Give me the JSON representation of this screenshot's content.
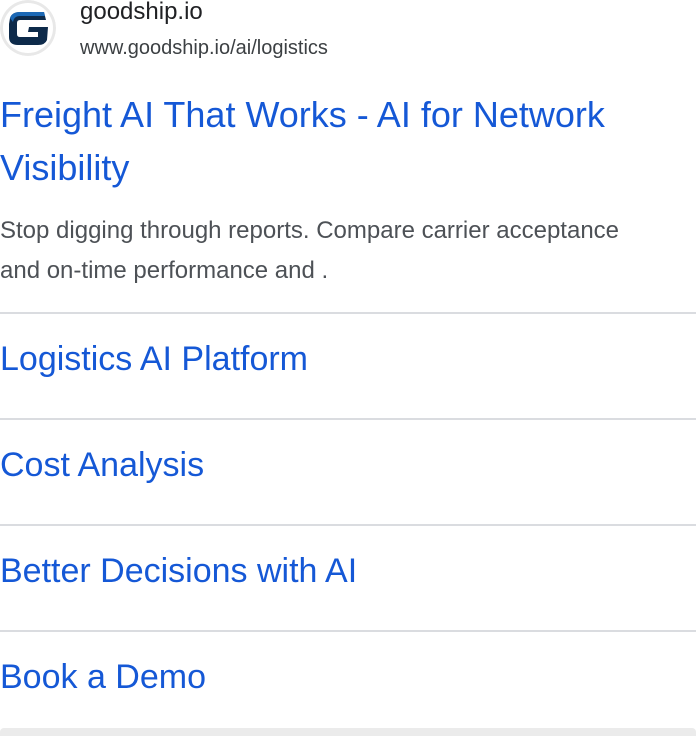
{
  "ad": {
    "site_name": "goodship.io",
    "display_url": "www.goodship.io/ai/logistics",
    "logo_icon": "goodship-g-logo",
    "headline": "Freight AI That Works - AI for Network Visibility",
    "description": "Stop digging through reports. Compare carrier acceptance and on-time performance and .",
    "sitelinks": [
      {
        "label": "Logistics AI Platform"
      },
      {
        "label": "Cost Analysis"
      },
      {
        "label": "Better Decisions with AI"
      },
      {
        "label": "Book a Demo"
      }
    ]
  },
  "colors": {
    "link": "#1558d6",
    "body_text": "#4d5156",
    "divider": "#dadce0",
    "logo_blue": "#0b5fa8"
  }
}
